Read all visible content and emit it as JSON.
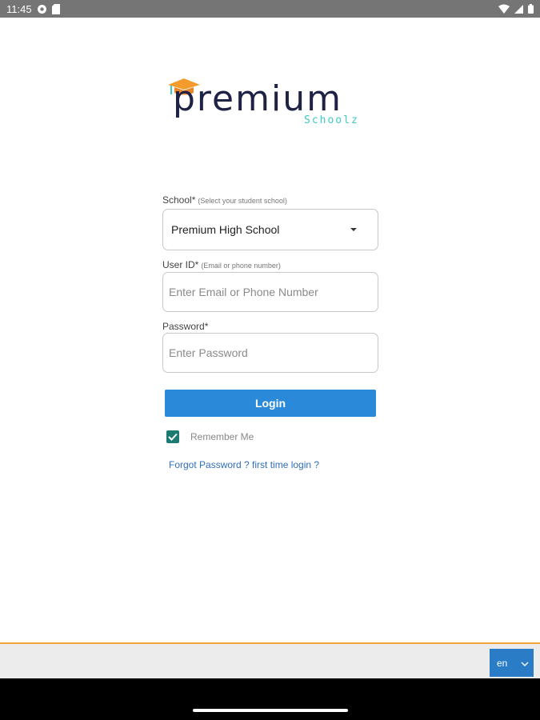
{
  "status_bar": {
    "time": "11:45",
    "left_icons": [
      "settings-gear-icon",
      "sd-card-icon"
    ],
    "right_icons": [
      "wifi-icon",
      "cell-signal-icon",
      "battery-icon"
    ]
  },
  "logo": {
    "word": "premium",
    "sub": "Schoolz"
  },
  "form": {
    "school": {
      "label": "School*",
      "hint": "(Select your student school)",
      "selected": "Premium High School"
    },
    "user_id": {
      "label": "User ID*",
      "hint": "(Email or phone number)",
      "placeholder": "Enter Email or Phone Number",
      "value": ""
    },
    "password": {
      "label": "Password*",
      "placeholder": "Enter Password",
      "value": ""
    },
    "login_label": "Login",
    "remember_label": "Remember Me",
    "remember_checked": true,
    "forgot_label": "Forgot Password ? first time login ?"
  },
  "footer": {
    "language": "en"
  },
  "colors": {
    "accent": "#2a8ad9",
    "checkbox": "#1d7a73",
    "footer_border": "#f2a33b",
    "link": "#2f6fba",
    "logo_dark": "#1e2245",
    "logo_teal": "#3ec9c0"
  }
}
